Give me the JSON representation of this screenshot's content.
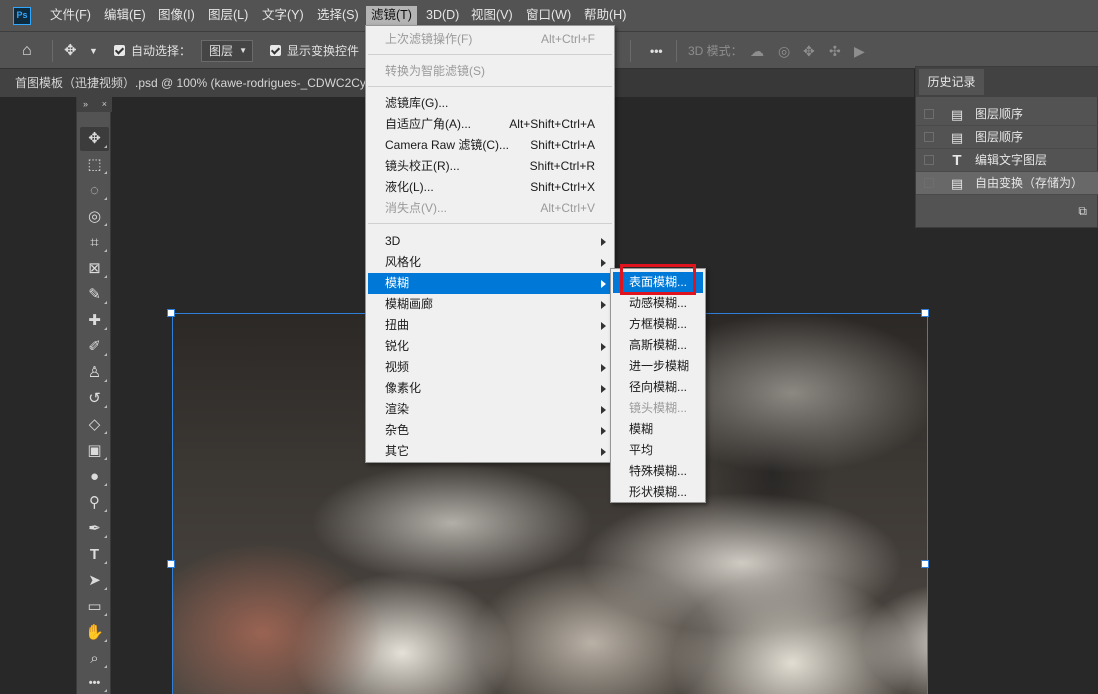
{
  "app": {
    "logo": "Ps"
  },
  "menubar": [
    {
      "label": "文件(F)"
    },
    {
      "label": "编辑(E)"
    },
    {
      "label": "图像(I)"
    },
    {
      "label": "图层(L)"
    },
    {
      "label": "文字(Y)"
    },
    {
      "label": "选择(S)"
    },
    {
      "label": "滤镜(T)"
    },
    {
      "label": "3D(D)"
    },
    {
      "label": "视图(V)"
    },
    {
      "label": "窗口(W)"
    },
    {
      "label": "帮助(H)"
    }
  ],
  "options_bar": {
    "auto_select_label": "自动选择：",
    "auto_select_target": "图层",
    "show_transform_label": "显示变换控件",
    "more_label": "•••",
    "mode_3d_label": "3D 模式："
  },
  "document_tab": {
    "title": "首图模板（迅捷视频）.psd @ 100% (kawe-rodrigues-_CDWC2Cy"
  },
  "history_panel": {
    "title": "历史记录",
    "items": [
      {
        "label": "图层顺序",
        "icon": "document-icon"
      },
      {
        "label": "图层顺序",
        "icon": "document-icon"
      },
      {
        "label": "编辑文字图层",
        "icon": "type-icon"
      },
      {
        "label": "自由变换（存储为）",
        "icon": "document-icon"
      }
    ]
  },
  "filter_menu": {
    "items": [
      {
        "label": "上次滤镜操作(F)",
        "shortcut": "Alt+Ctrl+F",
        "disabled": true
      },
      {
        "label": "转换为智能滤镜(S)",
        "shortcut": "",
        "disabled": true
      },
      {
        "label": "滤镜库(G)...",
        "shortcut": ""
      },
      {
        "label": "自适应广角(A)...",
        "shortcut": "Alt+Shift+Ctrl+A"
      },
      {
        "label": "Camera Raw 滤镜(C)...",
        "shortcut": "Shift+Ctrl+A"
      },
      {
        "label": "镜头校正(R)...",
        "shortcut": "Shift+Ctrl+R"
      },
      {
        "label": "液化(L)...",
        "shortcut": "Shift+Ctrl+X"
      },
      {
        "label": "消失点(V)...",
        "shortcut": "Alt+Ctrl+V",
        "disabled": true
      },
      {
        "label": "3D"
      },
      {
        "label": "风格化"
      },
      {
        "label": "模糊"
      },
      {
        "label": "模糊画廊"
      },
      {
        "label": "扭曲"
      },
      {
        "label": "锐化"
      },
      {
        "label": "视频"
      },
      {
        "label": "像素化"
      },
      {
        "label": "渲染"
      },
      {
        "label": "杂色"
      },
      {
        "label": "其它"
      }
    ]
  },
  "blur_submenu": {
    "items": [
      {
        "label": "表面模糊..."
      },
      {
        "label": "动感模糊..."
      },
      {
        "label": "方框模糊..."
      },
      {
        "label": "高斯模糊..."
      },
      {
        "label": "进一步模糊"
      },
      {
        "label": "径向模糊..."
      },
      {
        "label": "镜头模糊...",
        "disabled": true
      },
      {
        "label": "模糊"
      },
      {
        "label": "平均"
      },
      {
        "label": "特殊模糊..."
      },
      {
        "label": "形状模糊..."
      }
    ]
  },
  "toolbar": {
    "tools": [
      {
        "icon": "move-icon",
        "glyph": "✥"
      },
      {
        "icon": "marquee-icon",
        "glyph": "⬚"
      },
      {
        "icon": "lasso-icon",
        "glyph": "◌"
      },
      {
        "icon": "quick-select-icon",
        "glyph": "◎"
      },
      {
        "icon": "crop-icon",
        "glyph": "⌗"
      },
      {
        "icon": "frame-icon",
        "glyph": "⊠"
      },
      {
        "icon": "eyedropper-icon",
        "glyph": "✎"
      },
      {
        "icon": "healing-icon",
        "glyph": "✚"
      },
      {
        "icon": "brush-icon",
        "glyph": "✐"
      },
      {
        "icon": "stamp-icon",
        "glyph": "♙"
      },
      {
        "icon": "history-brush-icon",
        "glyph": "↺"
      },
      {
        "icon": "eraser-icon",
        "glyph": "◇"
      },
      {
        "icon": "gradient-icon",
        "glyph": "▣"
      },
      {
        "icon": "blur-tool-icon",
        "glyph": "●"
      },
      {
        "icon": "dodge-icon",
        "glyph": "⚲"
      },
      {
        "icon": "pen-icon",
        "glyph": "✒"
      },
      {
        "icon": "type-icon",
        "glyph": "T"
      },
      {
        "icon": "path-select-icon",
        "glyph": "➤"
      },
      {
        "icon": "rectangle-icon",
        "glyph": "▭"
      },
      {
        "icon": "hand-icon",
        "glyph": "✋"
      },
      {
        "icon": "zoom-icon",
        "glyph": "⌕"
      },
      {
        "icon": "more-tools-icon",
        "glyph": "•••"
      }
    ]
  },
  "colors": {
    "highlight": "#0078d7",
    "annotation_red": "#e0141e",
    "panel": "#535353",
    "workspace": "#282828"
  }
}
